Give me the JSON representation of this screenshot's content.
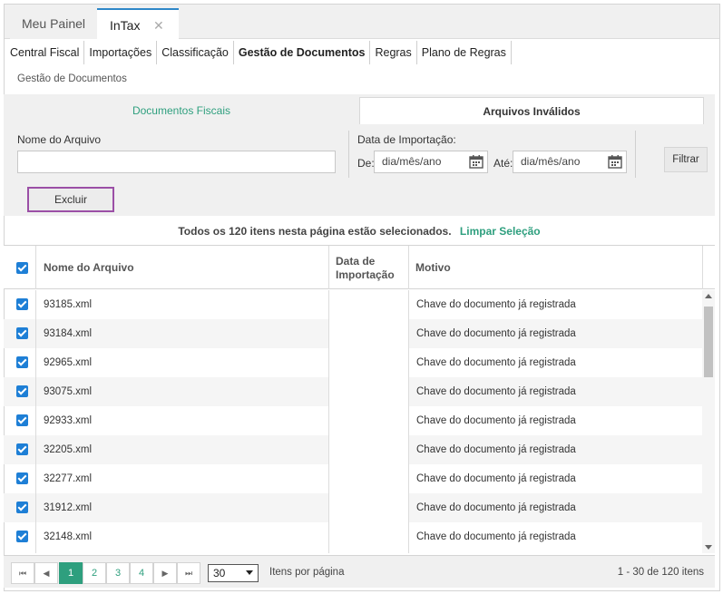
{
  "tabs": [
    {
      "label": "Meu Painel"
    },
    {
      "label": "InTax",
      "close": "✕"
    }
  ],
  "menu": [
    {
      "label": "Central Fiscal"
    },
    {
      "label": "Importações"
    },
    {
      "label": "Classificação"
    },
    {
      "label": "Gestão de Documentos"
    },
    {
      "label": "Regras"
    },
    {
      "label": "Plano de Regras"
    }
  ],
  "breadcrumb": "Gestão de Documentos",
  "subtabs": {
    "fiscais": "Documentos Fiscais",
    "invalidos": "Arquivos Inválidos"
  },
  "filters": {
    "filename_label": "Nome do Arquivo",
    "filename_value": "",
    "import_date_label": "Data de Importação:",
    "from_label": "De:",
    "from_placeholder": "dia/mês/ano",
    "to_label": "Até:",
    "to_placeholder": "dia/mês/ano",
    "filter_button": "Filtrar",
    "delete_button": "Excluir"
  },
  "selection": {
    "message": "Todos os 120 itens nesta página estão selecionados.",
    "clear_link": "Limpar Seleção"
  },
  "grid": {
    "columns": {
      "name": "Nome do Arquivo",
      "date_line1": "Data de",
      "date_line2": "Importação",
      "reason": "Motivo"
    },
    "rows": [
      {
        "file": "93185.xml",
        "date": "",
        "reason": "Chave do documento já registrada",
        "checked": true
      },
      {
        "file": "93184.xml",
        "date": "",
        "reason": "Chave do documento já registrada",
        "checked": true
      },
      {
        "file": "92965.xml",
        "date": "",
        "reason": "Chave do documento já registrada",
        "checked": true
      },
      {
        "file": "93075.xml",
        "date": "",
        "reason": "Chave do documento já registrada",
        "checked": true
      },
      {
        "file": "92933.xml",
        "date": "",
        "reason": "Chave do documento já registrada",
        "checked": true
      },
      {
        "file": "32205.xml",
        "date": "",
        "reason": "Chave do documento já registrada",
        "checked": true
      },
      {
        "file": "32277.xml",
        "date": "",
        "reason": "Chave do documento já registrada",
        "checked": true
      },
      {
        "file": "31912.xml",
        "date": "",
        "reason": "Chave do documento já registrada",
        "checked": true
      },
      {
        "file": "32148.xml",
        "date": "",
        "reason": "Chave do documento já registrada",
        "checked": true
      }
    ]
  },
  "pager": {
    "first": "⏮",
    "prev": "◀",
    "next": "▶",
    "last": "⏭",
    "pages": [
      "1",
      "2",
      "3",
      "4"
    ],
    "current_page": "1",
    "page_size": "30",
    "page_size_label": "Itens por página",
    "info": "1 - 30 de 120 itens"
  },
  "colors": {
    "accent": "#2e9f7e",
    "checkbox": "#1e7fd6",
    "tab_active_border": "#2f87c8",
    "excluir_border": "#9b4fa6"
  }
}
